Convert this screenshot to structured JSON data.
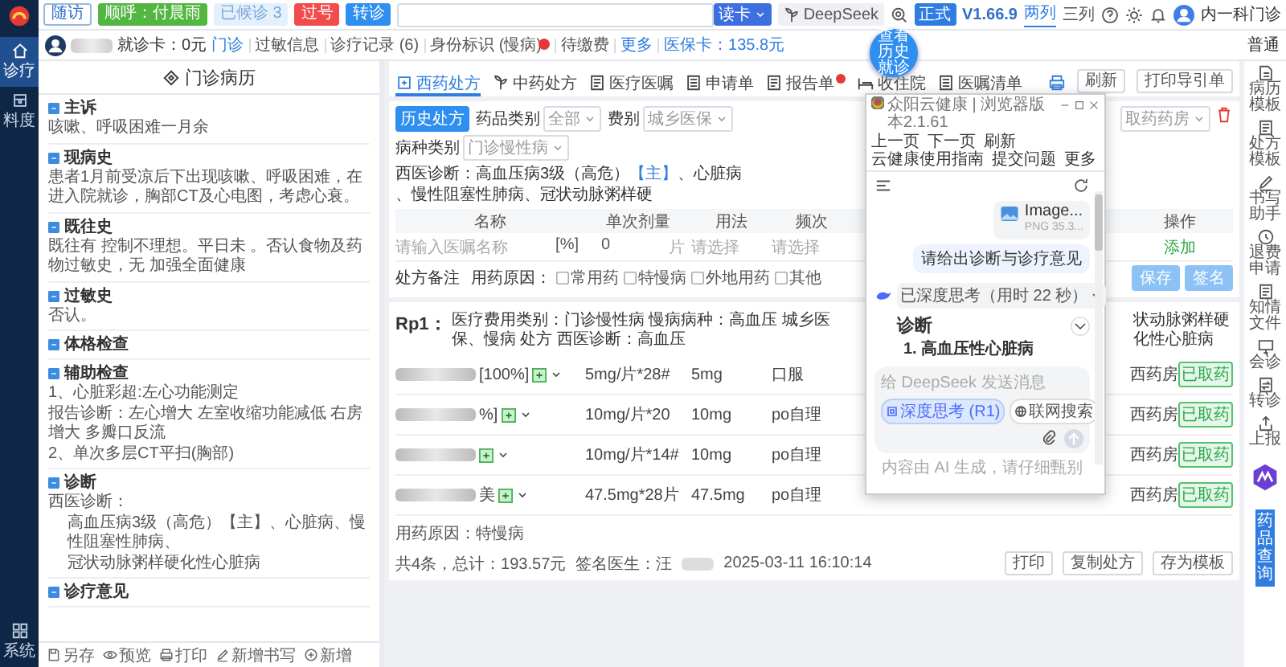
{
  "nav": {
    "items": [
      {
        "label": "诊疗",
        "selected": true
      },
      {
        "label": "料度",
        "selected": false
      }
    ],
    "bottom": {
      "label": "系统"
    }
  },
  "toolbar": {
    "buttons": [
      {
        "label": "随访",
        "kind": "outline"
      },
      {
        "label": "顺呼：付晨雨",
        "kind": "green"
      },
      {
        "label": "已候诊 3",
        "kind": "light"
      },
      {
        "label": "过号",
        "kind": "red"
      },
      {
        "label": "转诊",
        "kind": "blue"
      }
    ],
    "read_card": "读卡",
    "deepseek": "DeepSeek",
    "env": "正式",
    "version": "V1.66.9",
    "layouts": [
      {
        "label": "两列",
        "selected": true
      },
      {
        "label": "三列",
        "selected": false
      }
    ],
    "dept": "内一科门诊"
  },
  "patient": {
    "card": "就诊卡：0元",
    "visit": "门诊",
    "links": [
      {
        "label": "过敏信息",
        "alert": false
      },
      {
        "label": "诊疗记录 (6)",
        "alert": false
      },
      {
        "label": "身份标识 (慢病)",
        "alert": true
      },
      {
        "label": "待缴费",
        "alert": false
      }
    ],
    "more": "更多",
    "insurance": "医保卡：135.8元",
    "level": "普通"
  },
  "history_bubble": "查看历史就诊",
  "record": {
    "title": "门诊病历",
    "sections": [
      {
        "title": "主诉",
        "lines": [
          "咳嗽、呼吸困难一月余"
        ]
      },
      {
        "title": "现病史",
        "lines": [
          "患者1月前受凉后下出现咳嗽、呼吸困难，在进入院就诊，胸部CT及心电图，考虑心衰。"
        ]
      },
      {
        "title": "既往史",
        "lines": [
          "既往有 控制不理想。平日未 。否认食物及药物过敏史，无 加强全面健康"
        ]
      },
      {
        "title": "过敏史",
        "lines": [
          "否认。"
        ]
      },
      {
        "title": "体格检查"
      },
      {
        "title": "辅助检查",
        "lines": [
          "1、心脏彩超:左心功能测定",
          "报告诊断：左心增大 左室收缩功能减低 右房增大 多瓣口反流",
          "2、单次多层CT平扫(胸部)"
        ]
      },
      {
        "title": "诊断",
        "lines": [
          "西医诊断："
        ],
        "items": [
          "高血压病3级（高危）【主】、心脏病、慢性阻塞性肺病、",
          "冠状动脉粥样硬化性心脏病"
        ]
      },
      {
        "title": "诊疗意见"
      }
    ],
    "toolbar": [
      "另存",
      "预览",
      "打印",
      "新增书写",
      "新增"
    ]
  },
  "rx": {
    "tabs": [
      {
        "label": "西药处方",
        "selected": true,
        "alert": false
      },
      {
        "label": "中药处方",
        "selected": false,
        "alert": false
      },
      {
        "label": "医疗医嘱",
        "selected": false,
        "alert": false
      },
      {
        "label": "申请单",
        "selected": false,
        "alert": false
      },
      {
        "label": "报告单",
        "selected": false,
        "alert": true
      },
      {
        "label": "收住院",
        "selected": false,
        "alert": false
      },
      {
        "label": "医嘱清单",
        "selected": false,
        "alert": false
      }
    ],
    "actions": [
      "刷新",
      "打印导引单"
    ],
    "history_button": "历史处方",
    "filters": [
      {
        "label": "药品类别",
        "value": "全部"
      },
      {
        "label": "费别",
        "value": "城乡医保"
      },
      {
        "label": "病种类别",
        "value": "门诊慢性病"
      }
    ],
    "pharmacy": "取药药房",
    "diagnosis": {
      "label": "西医诊断：",
      "items": [
        {
          "text": "高血压病3级（高危）",
          "main": "【主】"
        },
        {
          "text": "、心脏病"
        },
        {
          "text": "、慢性阻塞性肺病"
        },
        {
          "text": "、冠状动脉粥样硬"
        }
      ]
    },
    "columns": [
      "名称",
      "单次剂量",
      "用法",
      "频次"
    ],
    "action_column": "操作",
    "entry": {
      "placeholder": "请输入医嘱名称",
      "unit": "[%]",
      "qty": "0",
      "qty_unit": "片",
      "selects": [
        "请选择",
        "请选择"
      ],
      "add": "添加"
    },
    "remark": {
      "label": "处方备注",
      "reason_label": "用药原因：",
      "reasons": [
        {
          "label": "常用药",
          "checked": false
        },
        {
          "label": "特慢病",
          "checked": false
        },
        {
          "label": "外地用药",
          "checked": false
        },
        {
          "label": "其他",
          "checked": false
        }
      ]
    },
    "form_buttons": [
      "保存",
      "签名"
    ],
    "rp": {
      "title": "Rp1：",
      "info": "医疗费用类别：门诊慢性病 慢病病种：高血压 城乡医保、慢病 处方 西医诊断：高血压",
      "info_right": "状动脉粥样硬化性心脏病",
      "rows": [
        {
          "name": "[100%]",
          "spec": "5mg/片*28#",
          "dose": "5mg",
          "usage": "口服",
          "pharmacy": "西药房",
          "status": "已取药"
        },
        {
          "name": "%]",
          "spec": "10mg/片*20",
          "dose": "10mg",
          "usage": "po自理",
          "pharmacy": "西药房",
          "status": "已取药"
        },
        {
          "spec": "10mg/片*14#",
          "dose": "10mg",
          "usage": "po自理",
          "pharmacy": "西药房",
          "status": "已取药"
        },
        {
          "name": "美",
          "spec": "47.5mg*28片",
          "dose": "47.5mg",
          "usage": "po自理",
          "pharmacy": "西药房",
          "status": "已取药"
        }
      ],
      "reason": "用药原因：特慢病",
      "total": "共4条，总计：193.57元",
      "doctor": "签名医生：汪",
      "time": "2025-03-11 16:10:14",
      "buttons": [
        "打印",
        "复制处方",
        "存为模板"
      ]
    }
  },
  "chat": {
    "title": "众阳云健康 | 浏览器版本2.1.61",
    "menu": [
      "上一页",
      "下一页",
      "刷新",
      "云健康使用指南",
      "提交问题",
      "更多"
    ],
    "file": {
      "name": "Image...",
      "meta": "PNG 35.3..."
    },
    "question": "请给出诊断与诊疗意见",
    "thinking": "已深度思考（用时 22 秒）",
    "heading": "诊断",
    "answer": "1. 高血压性心脏病",
    "placeholder": "给 DeepSeek 发送消息",
    "chips": [
      {
        "label": "深度思考 (R1)",
        "selected": true
      },
      {
        "label": "联网搜索",
        "selected": false
      }
    ],
    "footer": "内容由 AI 生成，请仔细甄别"
  },
  "tools": [
    "病历模板",
    "处方模板",
    "书写助手",
    "退费申请",
    "知情文件",
    "会诊",
    "转诊",
    "上报"
  ],
  "side_tab": "药品查询"
}
